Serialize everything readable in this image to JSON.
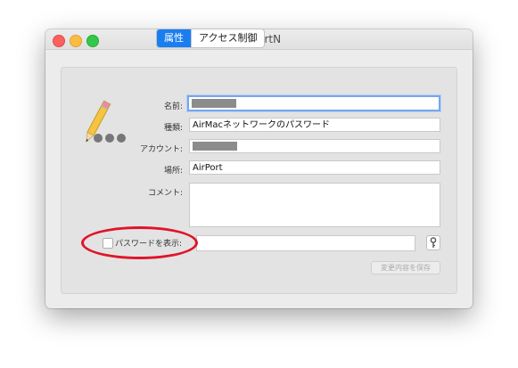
{
  "window": {
    "title": "AirPortN",
    "controls": {
      "close": "close-button",
      "minimize": "minimize-button",
      "zoom": "zoom-button"
    }
  },
  "tabs": [
    {
      "label": "属性",
      "active": true
    },
    {
      "label": "アクセス制御",
      "active": false
    }
  ],
  "icon": "pencil-key-icon",
  "form": {
    "name_label": "名前:",
    "name_value": "",
    "kind_label": "種類:",
    "kind_value": "AirMacネットワークのパスワード",
    "account_label": "アカウント:",
    "account_value": "",
    "where_label": "場所:",
    "where_value": "AirPort",
    "comment_label": "コメント:",
    "comment_value": ""
  },
  "show_password": {
    "label": "パスワードを表示:",
    "checked": false,
    "value": ""
  },
  "save_button": "変更内容を保存",
  "annotation_color": "#e0142a",
  "accent": "#1a7ef0"
}
